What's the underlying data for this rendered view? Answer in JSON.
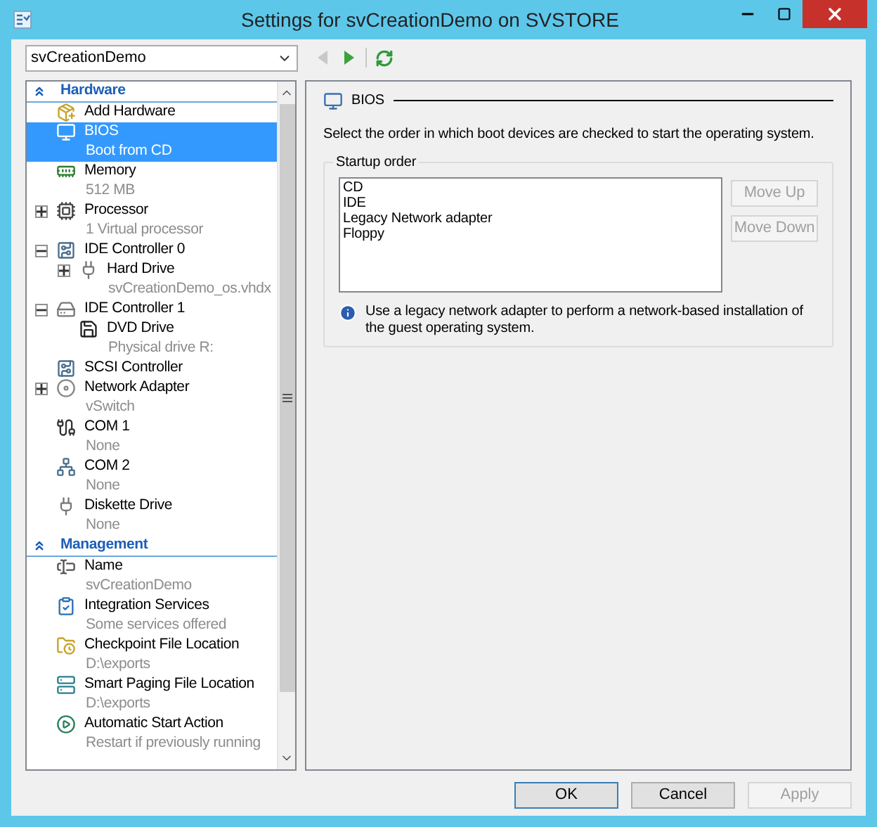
{
  "window": {
    "title": "Settings for svCreationDemo on SVSTORE"
  },
  "vm_selector": {
    "value": "svCreationDemo"
  },
  "toolbar": {
    "back_enabled": false,
    "forward_enabled": true
  },
  "tree": {
    "sections": [
      {
        "title": "Hardware",
        "items": [
          {
            "label": "Add Hardware",
            "selected": false
          },
          {
            "label": "BIOS",
            "detail": "Boot from CD",
            "selected": true
          },
          {
            "label": "Memory",
            "detail": "512 MB",
            "selected": false
          },
          {
            "label": "Processor",
            "detail": "1 Virtual processor",
            "selected": false,
            "expanded": false
          },
          {
            "label": "IDE Controller 0",
            "selected": false,
            "expanded": true,
            "children": [
              {
                "label": "Hard Drive",
                "detail": "svCreationDemo_os.vhdx",
                "selected": false,
                "expanded": false
              }
            ]
          },
          {
            "label": "IDE Controller 1",
            "selected": false,
            "expanded": true,
            "children": [
              {
                "label": "DVD Drive",
                "detail": "Physical drive R:",
                "selected": false
              }
            ]
          },
          {
            "label": "SCSI Controller",
            "selected": false
          },
          {
            "label": "Network Adapter",
            "detail": "vSwitch",
            "selected": false,
            "expanded": false
          },
          {
            "label": "COM 1",
            "detail": "None",
            "selected": false
          },
          {
            "label": "COM 2",
            "detail": "None",
            "selected": false
          },
          {
            "label": "Diskette Drive",
            "detail": "None",
            "selected": false
          }
        ]
      },
      {
        "title": "Management",
        "items": [
          {
            "label": "Name",
            "detail": "svCreationDemo",
            "selected": false
          },
          {
            "label": "Integration Services",
            "detail": "Some services offered",
            "selected": false
          },
          {
            "label": "Checkpoint File Location",
            "detail": "D:\\exports",
            "selected": false
          },
          {
            "label": "Smart Paging File Location",
            "detail": "D:\\exports",
            "selected": false
          },
          {
            "label": "Automatic Start Action",
            "detail": "Restart if previously running",
            "selected": false
          }
        ]
      }
    ]
  },
  "detail": {
    "heading": "BIOS",
    "description": "Select the order in which boot devices are checked to start the operating system.",
    "startup_order": {
      "legend": "Startup order",
      "devices": [
        "CD",
        "IDE",
        "Legacy Network adapter",
        "Floppy"
      ],
      "buttons": [
        {
          "label": "Move Up",
          "disabled": true
        },
        {
          "label": "Move Down",
          "disabled": true
        }
      ]
    },
    "info": "Use a legacy network adapter to perform a network-based installation of the guest operating system."
  },
  "buttons": [
    {
      "label": "OK",
      "disabled": false,
      "default": true
    },
    {
      "label": "Cancel",
      "disabled": false,
      "default": false
    },
    {
      "label": "Apply",
      "disabled": true,
      "default": false
    }
  ]
}
